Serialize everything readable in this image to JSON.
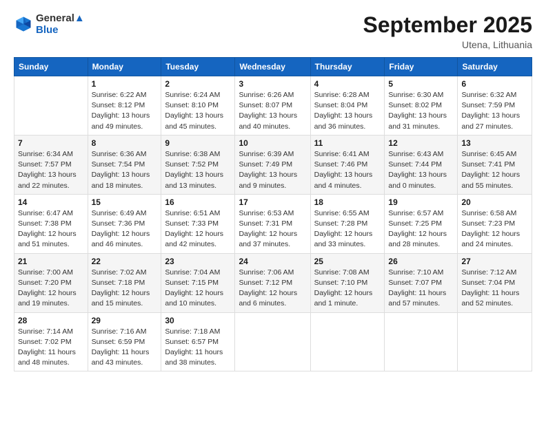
{
  "header": {
    "logo_line1": "General",
    "logo_line2": "Blue",
    "month": "September 2025",
    "location": "Utena, Lithuania"
  },
  "weekdays": [
    "Sunday",
    "Monday",
    "Tuesday",
    "Wednesday",
    "Thursday",
    "Friday",
    "Saturday"
  ],
  "weeks": [
    [
      {
        "day": "",
        "info": ""
      },
      {
        "day": "1",
        "info": "Sunrise: 6:22 AM\nSunset: 8:12 PM\nDaylight: 13 hours\nand 49 minutes."
      },
      {
        "day": "2",
        "info": "Sunrise: 6:24 AM\nSunset: 8:10 PM\nDaylight: 13 hours\nand 45 minutes."
      },
      {
        "day": "3",
        "info": "Sunrise: 6:26 AM\nSunset: 8:07 PM\nDaylight: 13 hours\nand 40 minutes."
      },
      {
        "day": "4",
        "info": "Sunrise: 6:28 AM\nSunset: 8:04 PM\nDaylight: 13 hours\nand 36 minutes."
      },
      {
        "day": "5",
        "info": "Sunrise: 6:30 AM\nSunset: 8:02 PM\nDaylight: 13 hours\nand 31 minutes."
      },
      {
        "day": "6",
        "info": "Sunrise: 6:32 AM\nSunset: 7:59 PM\nDaylight: 13 hours\nand 27 minutes."
      }
    ],
    [
      {
        "day": "7",
        "info": "Sunrise: 6:34 AM\nSunset: 7:57 PM\nDaylight: 13 hours\nand 22 minutes."
      },
      {
        "day": "8",
        "info": "Sunrise: 6:36 AM\nSunset: 7:54 PM\nDaylight: 13 hours\nand 18 minutes."
      },
      {
        "day": "9",
        "info": "Sunrise: 6:38 AM\nSunset: 7:52 PM\nDaylight: 13 hours\nand 13 minutes."
      },
      {
        "day": "10",
        "info": "Sunrise: 6:39 AM\nSunset: 7:49 PM\nDaylight: 13 hours\nand 9 minutes."
      },
      {
        "day": "11",
        "info": "Sunrise: 6:41 AM\nSunset: 7:46 PM\nDaylight: 13 hours\nand 4 minutes."
      },
      {
        "day": "12",
        "info": "Sunrise: 6:43 AM\nSunset: 7:44 PM\nDaylight: 13 hours\nand 0 minutes."
      },
      {
        "day": "13",
        "info": "Sunrise: 6:45 AM\nSunset: 7:41 PM\nDaylight: 12 hours\nand 55 minutes."
      }
    ],
    [
      {
        "day": "14",
        "info": "Sunrise: 6:47 AM\nSunset: 7:38 PM\nDaylight: 12 hours\nand 51 minutes."
      },
      {
        "day": "15",
        "info": "Sunrise: 6:49 AM\nSunset: 7:36 PM\nDaylight: 12 hours\nand 46 minutes."
      },
      {
        "day": "16",
        "info": "Sunrise: 6:51 AM\nSunset: 7:33 PM\nDaylight: 12 hours\nand 42 minutes."
      },
      {
        "day": "17",
        "info": "Sunrise: 6:53 AM\nSunset: 7:31 PM\nDaylight: 12 hours\nand 37 minutes."
      },
      {
        "day": "18",
        "info": "Sunrise: 6:55 AM\nSunset: 7:28 PM\nDaylight: 12 hours\nand 33 minutes."
      },
      {
        "day": "19",
        "info": "Sunrise: 6:57 AM\nSunset: 7:25 PM\nDaylight: 12 hours\nand 28 minutes."
      },
      {
        "day": "20",
        "info": "Sunrise: 6:58 AM\nSunset: 7:23 PM\nDaylight: 12 hours\nand 24 minutes."
      }
    ],
    [
      {
        "day": "21",
        "info": "Sunrise: 7:00 AM\nSunset: 7:20 PM\nDaylight: 12 hours\nand 19 minutes."
      },
      {
        "day": "22",
        "info": "Sunrise: 7:02 AM\nSunset: 7:18 PM\nDaylight: 12 hours\nand 15 minutes."
      },
      {
        "day": "23",
        "info": "Sunrise: 7:04 AM\nSunset: 7:15 PM\nDaylight: 12 hours\nand 10 minutes."
      },
      {
        "day": "24",
        "info": "Sunrise: 7:06 AM\nSunset: 7:12 PM\nDaylight: 12 hours\nand 6 minutes."
      },
      {
        "day": "25",
        "info": "Sunrise: 7:08 AM\nSunset: 7:10 PM\nDaylight: 12 hours\nand 1 minute."
      },
      {
        "day": "26",
        "info": "Sunrise: 7:10 AM\nSunset: 7:07 PM\nDaylight: 11 hours\nand 57 minutes."
      },
      {
        "day": "27",
        "info": "Sunrise: 7:12 AM\nSunset: 7:04 PM\nDaylight: 11 hours\nand 52 minutes."
      }
    ],
    [
      {
        "day": "28",
        "info": "Sunrise: 7:14 AM\nSunset: 7:02 PM\nDaylight: 11 hours\nand 48 minutes."
      },
      {
        "day": "29",
        "info": "Sunrise: 7:16 AM\nSunset: 6:59 PM\nDaylight: 11 hours\nand 43 minutes."
      },
      {
        "day": "30",
        "info": "Sunrise: 7:18 AM\nSunset: 6:57 PM\nDaylight: 11 hours\nand 38 minutes."
      },
      {
        "day": "",
        "info": ""
      },
      {
        "day": "",
        "info": ""
      },
      {
        "day": "",
        "info": ""
      },
      {
        "day": "",
        "info": ""
      }
    ]
  ]
}
